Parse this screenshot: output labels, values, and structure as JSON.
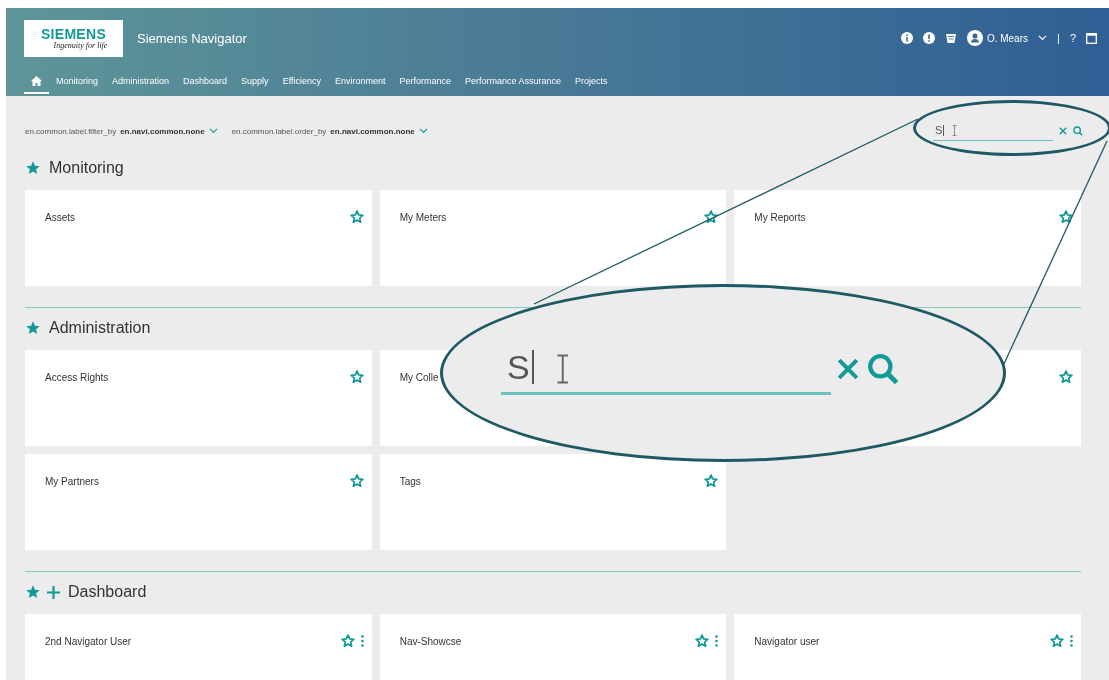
{
  "header": {
    "logo": {
      "brand": "SIEMENS",
      "tagline": "Ingenuity for life"
    },
    "title": "Siemens Navigator",
    "user": "O. Mears",
    "separator": "|",
    "help": "?"
  },
  "nav": [
    {
      "kind": "home",
      "selected": true
    },
    {
      "kind": "link",
      "label": "Monitoring",
      "selected": false
    },
    {
      "kind": "link",
      "label": "Administration",
      "selected": false
    },
    {
      "kind": "link",
      "label": "Dashboard",
      "selected": false
    },
    {
      "kind": "link",
      "label": "Supply",
      "selected": false
    },
    {
      "kind": "link",
      "label": "Efficiency",
      "selected": false
    },
    {
      "kind": "link",
      "label": "Environment",
      "selected": false
    },
    {
      "kind": "link",
      "label": "Performance",
      "selected": false
    },
    {
      "kind": "link",
      "label": "Performance Assurance",
      "selected": false
    },
    {
      "kind": "link",
      "label": "Projects",
      "selected": false
    }
  ],
  "filters": [
    {
      "label": "en.common.label.filter_by",
      "value": "en.navi.common.none"
    },
    {
      "label": "en.common.label.order_by",
      "value": "en.navi.common.none"
    }
  ],
  "search": {
    "value": "S"
  },
  "sections": [
    {
      "title": "Monitoring",
      "starred": true,
      "cards": [
        {
          "title": "Assets",
          "starred": false
        },
        {
          "title": "My Meters",
          "starred": false
        },
        {
          "title": "My Reports",
          "starred": false
        }
      ]
    },
    {
      "title": "Administration",
      "starred": true,
      "cards": [
        {
          "title": "Access Rights",
          "starred": false
        },
        {
          "title": "My Colle"
        },
        {
          "starred": false
        },
        {
          "title": "My Partners",
          "starred": false
        },
        {
          "title": "Tags",
          "starred": false
        }
      ]
    },
    {
      "title": "Dashboard",
      "starred": true,
      "can_add": true,
      "cards": [
        {
          "title": "2nd Navigator User",
          "starred": false,
          "menu": true
        },
        {
          "title": "Nav-Showcse",
          "starred": false,
          "menu": true
        },
        {
          "title": "Navigator user",
          "starred": false,
          "menu": true
        }
      ]
    }
  ],
  "magnifier": {
    "value": "S"
  }
}
